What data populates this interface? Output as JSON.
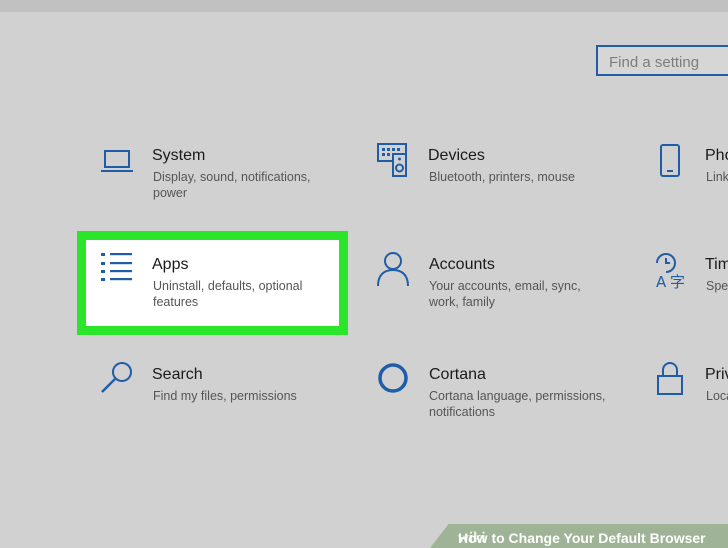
{
  "search": {
    "placeholder": "Find a setting"
  },
  "tiles": {
    "system": {
      "title": "System",
      "desc1": "Display, sound, notifications,",
      "desc2": "power"
    },
    "devices": {
      "title": "Devices",
      "desc1": "Bluetooth, printers, mouse",
      "desc2": ""
    },
    "phone": {
      "title": "Pho",
      "desc1": "Link",
      "desc2": ""
    },
    "apps": {
      "title": "Apps",
      "desc1": "Uninstall, defaults, optional",
      "desc2": "features"
    },
    "accounts": {
      "title": "Accounts",
      "desc1": "Your accounts, email, sync,",
      "desc2": "work, family"
    },
    "time": {
      "title": "Tim",
      "desc1": "Spe",
      "desc2": ""
    },
    "search": {
      "title": "Search",
      "desc1": "Find my files, permissions",
      "desc2": ""
    },
    "cortana": {
      "title": "Cortana",
      "desc1": "Cortana language, permissions,",
      "desc2": "notifications"
    },
    "privacy": {
      "title": "Priv",
      "desc1": "Loca",
      "desc2": ""
    }
  },
  "watermark": {
    "wiki": "wiki",
    "text": "How to Change Your Default Browser"
  },
  "colors": {
    "accent": "#1f5da6",
    "highlight": "#2ae52a",
    "background": "#d1d1d1"
  },
  "icons": [
    "laptop-icon",
    "keyboard-speaker-icon",
    "phone-icon",
    "list-icon",
    "person-icon",
    "time-language-icon",
    "search-icon",
    "cortana-ring-icon",
    "lock-icon"
  ]
}
